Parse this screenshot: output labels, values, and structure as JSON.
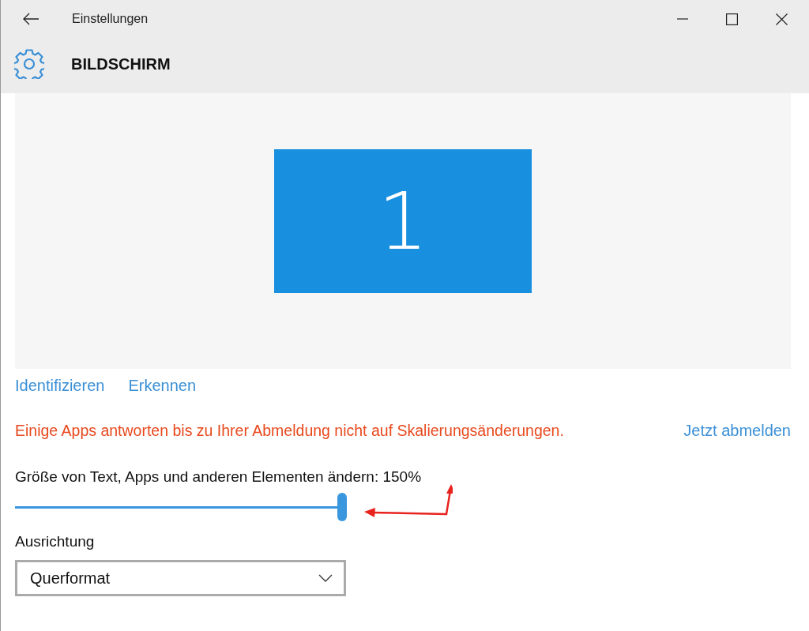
{
  "window": {
    "title": "Einstellungen"
  },
  "page": {
    "title": "BILDSCHIRM"
  },
  "display_preview": {
    "displays": [
      {
        "label": "1"
      }
    ]
  },
  "links": [
    "Identifizieren",
    "Erkennen"
  ],
  "notice": {
    "text": "Einige Apps antworten bis zu Ihrer Abmeldung nicht auf Skalierungsänderungen.",
    "action": "Jetzt abmelden"
  },
  "scale": {
    "label": "Größe von Text, Apps und anderen Elementen ändern: 150%",
    "level": 1
  },
  "orientation": {
    "label": "Ausrichtung",
    "value": "Querformat"
  }
}
